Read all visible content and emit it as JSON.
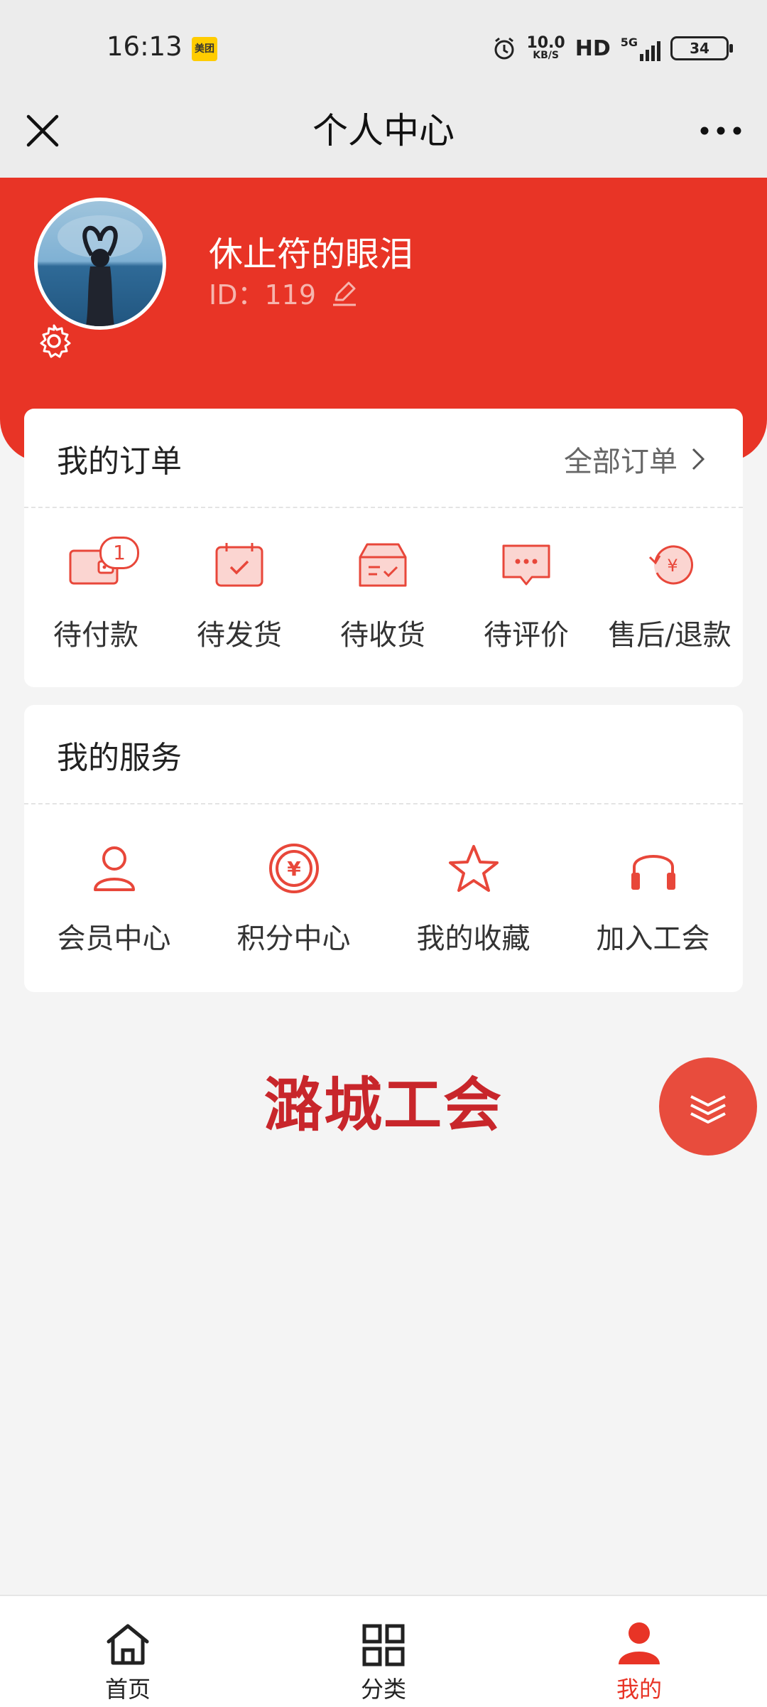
{
  "status_bar": {
    "time": "16:13",
    "app_badge": "美团",
    "speed_value": "10.0",
    "speed_unit": "KB/S",
    "hd": "HD",
    "network": "5G",
    "battery": "34"
  },
  "nav": {
    "title": "个人中心",
    "close_icon": "close-icon",
    "more_icon": "more-icon"
  },
  "profile": {
    "name": "休止符的眼泪",
    "id_text": "ID：119"
  },
  "orders": {
    "title": "我的订单",
    "all_label": "全部订单",
    "items": [
      {
        "label": "待付款",
        "icon": "wallet-icon",
        "badge": "1"
      },
      {
        "label": "待发货",
        "icon": "calendar-check-icon"
      },
      {
        "label": "待收货",
        "icon": "box-icon"
      },
      {
        "label": "待评价",
        "icon": "comment-icon"
      },
      {
        "label": "售后/退款",
        "icon": "refund-icon"
      }
    ]
  },
  "services": {
    "title": "我的服务",
    "items": [
      {
        "label": "会员中心",
        "icon": "user-icon"
      },
      {
        "label": "积分中心",
        "icon": "points-icon"
      },
      {
        "label": "我的收藏",
        "icon": "star-icon"
      },
      {
        "label": "加入工会",
        "icon": "headset-icon"
      }
    ]
  },
  "brand": "潞城工会",
  "tabbar": {
    "items": [
      {
        "label": "首页",
        "icon": "home-icon",
        "active": false
      },
      {
        "label": "分类",
        "icon": "grid-icon",
        "active": false
      },
      {
        "label": "我的",
        "icon": "profile-icon",
        "active": true
      }
    ]
  },
  "colors": {
    "primary": "#e83426",
    "icon_red": "#e8473a",
    "background": "#f4f4f4"
  }
}
